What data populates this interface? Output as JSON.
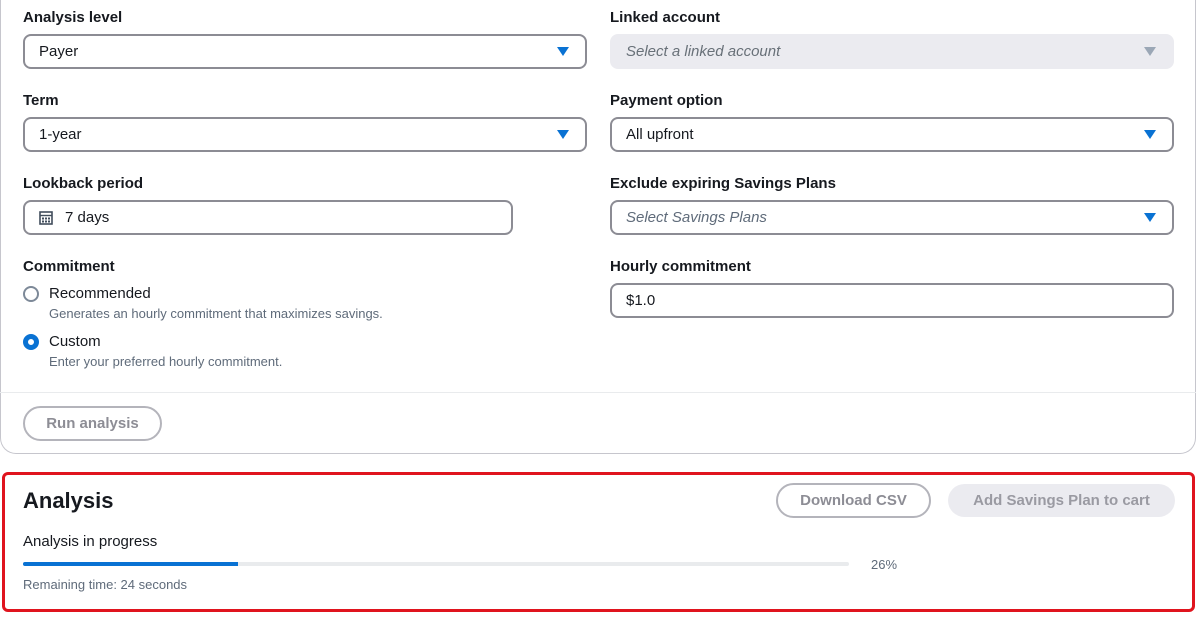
{
  "form": {
    "analysis_level": {
      "label": "Analysis level",
      "value": "Payer"
    },
    "linked_account": {
      "label": "Linked account",
      "placeholder": "Select a linked account"
    },
    "term": {
      "label": "Term",
      "value": "1-year"
    },
    "payment_option": {
      "label": "Payment option",
      "value": "All upfront"
    },
    "lookback_period": {
      "label": "Lookback period",
      "value": "7 days"
    },
    "exclude_expiring": {
      "label": "Exclude expiring Savings Plans",
      "placeholder": "Select Savings Plans"
    },
    "commitment": {
      "label": "Commitment",
      "options": [
        {
          "label": "Recommended",
          "description": "Generates an hourly commitment that maximizes savings.",
          "checked": false
        },
        {
          "label": "Custom",
          "description": "Enter your preferred hourly commitment.",
          "checked": true
        }
      ]
    },
    "hourly_commitment": {
      "label": "Hourly commitment",
      "value": "$1.0"
    },
    "run_button": "Run analysis"
  },
  "analysis": {
    "title": "Analysis",
    "download_button": "Download CSV",
    "add_to_cart_button": "Add Savings Plan to cart",
    "progress_label": "Analysis in progress",
    "progress_percent": 26,
    "progress_percent_text": "26%",
    "remaining_text": "Remaining time: 24 seconds"
  },
  "colors": {
    "accent": "#0972d3",
    "highlight": "#e0141e"
  }
}
